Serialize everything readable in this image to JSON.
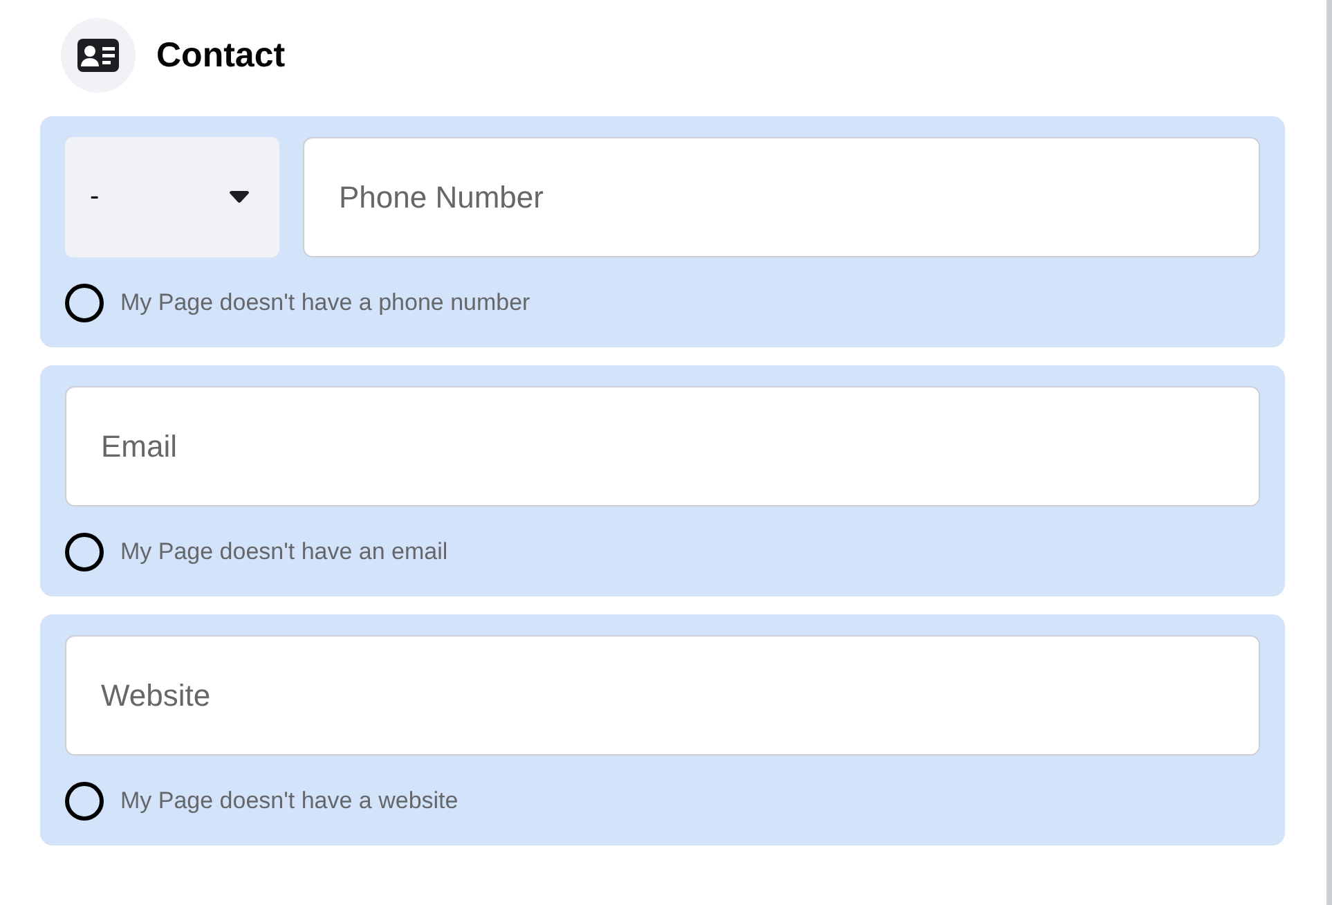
{
  "header": {
    "title": "Contact"
  },
  "sections": [
    {
      "kind": "phone",
      "select": {
        "value": "-"
      },
      "field": {
        "placeholder": "Phone Number"
      },
      "option": {
        "label": "My Page doesn't have a phone number",
        "selected": false
      }
    },
    {
      "kind": "plain",
      "field": {
        "placeholder": "Email"
      },
      "option": {
        "label": "My Page doesn't have an email",
        "selected": false
      }
    },
    {
      "kind": "plain",
      "field": {
        "placeholder": "Website"
      },
      "option": {
        "label": "My Page doesn't have a website",
        "selected": false
      }
    }
  ]
}
